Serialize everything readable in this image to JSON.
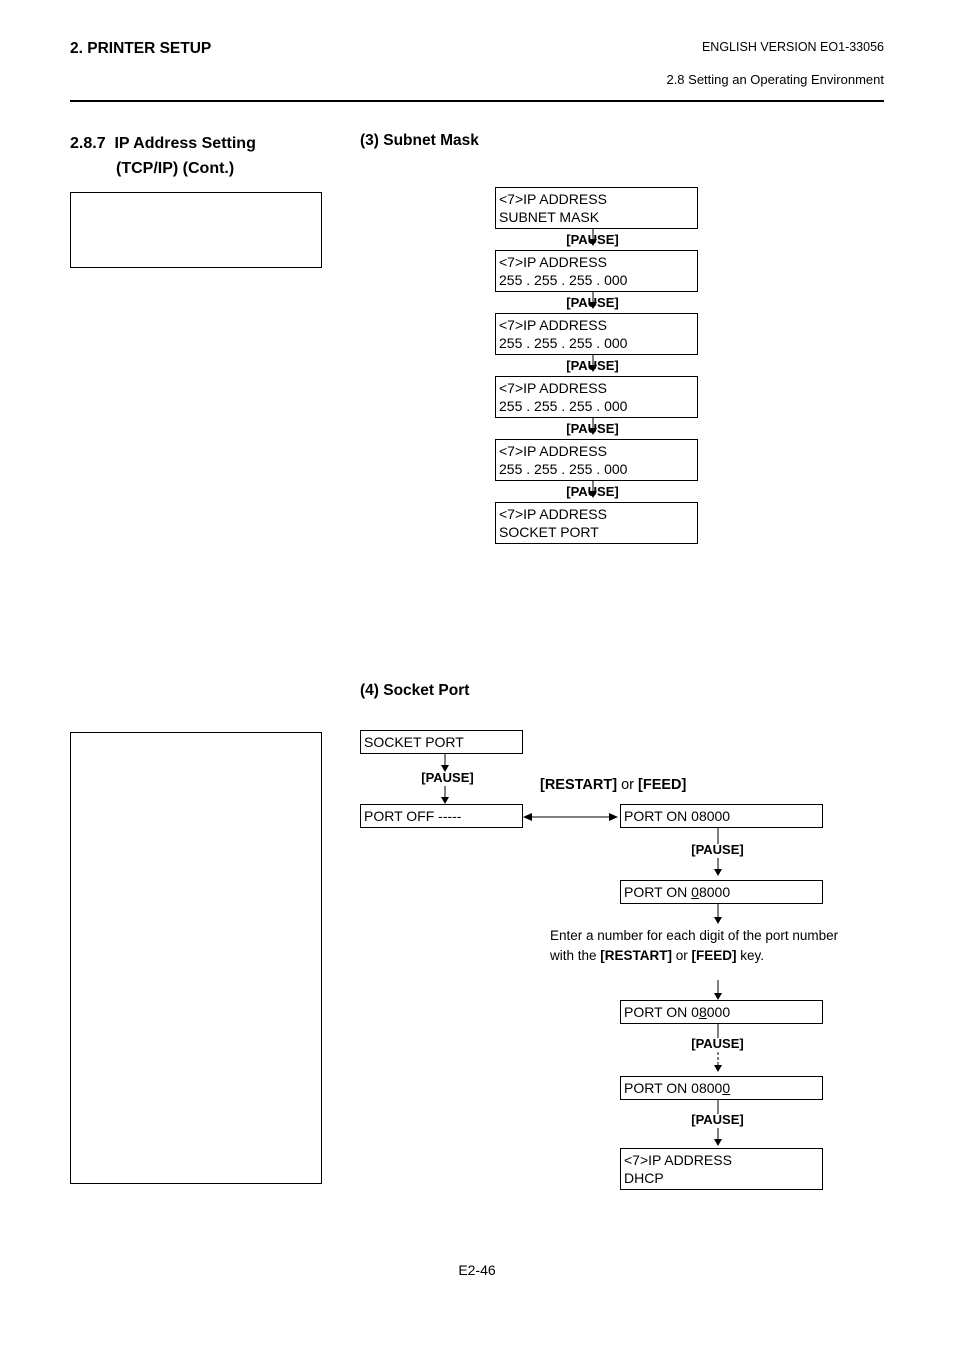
{
  "header": {
    "left": "2. PRINTER SETUP",
    "right1": "ENGLISH VERSION EO1-33056",
    "right2": "2.8 Setting an Operating Environment"
  },
  "section_left": {
    "num": "2.8.7",
    "title": "IP Address Setting",
    "sub": "(TCP/IP) (Cont.)"
  },
  "subnet": {
    "heading": "(3)  Subnet Mask",
    "steps": [
      {
        "l1": "<7>IP ADDRESS",
        "l2": "SUBNET MASK"
      },
      {
        "l1": "<7>IP ADDRESS",
        "l2": "255 . 255 . 255 . 000"
      },
      {
        "l1": "<7>IP ADDRESS",
        "l2": "255 . 255 . 255 . 000"
      },
      {
        "l1": "<7>IP ADDRESS",
        "l2": "255 . 255 . 255 . 000"
      },
      {
        "l1": "<7>IP ADDRESS",
        "l2": "255 . 255 . 255 . 000"
      },
      {
        "l1": "<7>IP ADDRESS",
        "l2": "SOCKET PORT"
      }
    ],
    "pause": "[PAUSE]"
  },
  "socket": {
    "heading": "(4)  Socket Port",
    "start": "SOCKET PORT",
    "pause": "[PAUSE]",
    "restart_or_feed_a": "[RESTART]",
    "restart_or_feed_b": " or ",
    "restart_or_feed_c": "[FEED]",
    "port_off": "PORT OFF -----",
    "port_on_1": "PORT ON  08000",
    "port_on_2a": "PORT ON  ",
    "port_on_2b": "0",
    "port_on_2c": "8000",
    "port_on_3a": "PORT ON  0",
    "port_on_3b": "8",
    "port_on_3c": "000",
    "port_on_4a": "PORT ON  0800",
    "port_on_4b": "0",
    "instr_a": "Enter a number for each digit of the port number with the ",
    "instr_b": "[RESTART]",
    "instr_c": " or ",
    "instr_d": "[FEED]",
    "instr_e": " key.",
    "final_l1": "<7>IP ADDRESS",
    "final_l2": "DHCP"
  },
  "footer": "E2-46"
}
